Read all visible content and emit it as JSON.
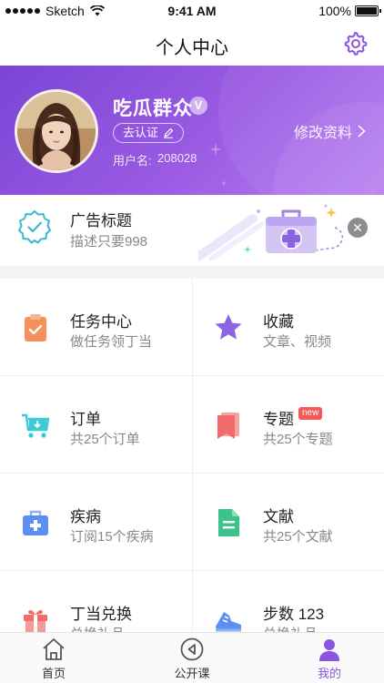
{
  "status_bar": {
    "carrier": "Sketch",
    "time": "9:41 AM",
    "battery": "100%"
  },
  "nav": {
    "title": "个人中心",
    "settings_icon": "gear-icon"
  },
  "profile": {
    "name": "吃瓜群众",
    "badge": "V",
    "verify_label": "去认证",
    "user_id_label": "用户名:",
    "user_id": "208028",
    "edit_label": "修改资料"
  },
  "ad": {
    "title": "广告标题",
    "description": "描述只要998",
    "close_icon": "close-icon"
  },
  "grid": [
    {
      "key": "tasks",
      "title": "任务中心",
      "sub": "做任务领丁当",
      "icon": "clipboard-icon",
      "color": "#f5905a"
    },
    {
      "key": "favorites",
      "title": "收藏",
      "sub": "文章、视频",
      "icon": "star-icon",
      "color": "#8e63e6"
    },
    {
      "key": "orders",
      "title": "订单",
      "sub": "共25个订单",
      "icon": "cart-icon",
      "color": "#3ccad6"
    },
    {
      "key": "topics",
      "title": "专题",
      "sub": "共25个专题",
      "icon": "bookmark-icon",
      "color": "#f26b6b",
      "badge": "new"
    },
    {
      "key": "diseases",
      "title": "疾病",
      "sub": "订阅15个疾病",
      "icon": "medkit-icon",
      "color": "#5b8ff0"
    },
    {
      "key": "literature",
      "title": "文献",
      "sub": "共25个文献",
      "icon": "document-icon",
      "color": "#3cc28a"
    },
    {
      "key": "redeem",
      "title": "丁当兑换",
      "sub": "兑换礼品",
      "icon": "gift-icon",
      "color": "#f26b6b"
    },
    {
      "key": "steps",
      "title": "步数 123",
      "sub": "兑换礼品",
      "icon": "shoe-icon",
      "color": "#5b8ff0"
    }
  ],
  "tabbar": [
    {
      "label": "首页",
      "icon": "home-icon",
      "active": false
    },
    {
      "label": "公开课",
      "icon": "play-icon",
      "active": false
    },
    {
      "label": "我的",
      "icon": "profile-icon",
      "active": true
    }
  ],
  "colors": {
    "accent": "#8a55e0",
    "header_start": "#7b45d6",
    "header_end": "#b77ef0"
  }
}
